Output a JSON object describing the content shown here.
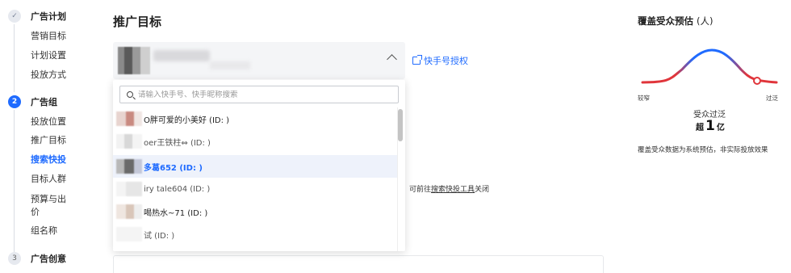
{
  "steps": [
    {
      "title": "广告计划",
      "badge": "✓",
      "state": "done",
      "items": [
        "营销目标",
        "计划设置",
        "投放方式"
      ]
    },
    {
      "title": "广告组",
      "badge": "2",
      "state": "active",
      "items": [
        "投放位置",
        "推广目标",
        "搜索快投",
        "目标人群",
        "预算与出",
        "价",
        "组名称"
      ],
      "current": "搜索快投"
    },
    {
      "title": "广告创意",
      "badge": "3",
      "state": "todo"
    }
  ],
  "main": {
    "title": "推广目标",
    "auth_link": "快手号授权",
    "hint_prefix": "可前往",
    "hint_link": "搜索快投工具",
    "hint_suffix": "关闭"
  },
  "dropdown": {
    "search_placeholder": "请输入快手号、快手昵称搜索",
    "options": [
      {
        "text": "O胖可爱的小美好 (ID:                  )",
        "state": "normal"
      },
      {
        "text": "oer王铁柱⇔ (ID:                  )",
        "state": "dim"
      },
      {
        "text": "多葛652 (ID:                    )",
        "state": "selected"
      },
      {
        "text": "iry tale604 (ID:                  )",
        "state": "dim"
      },
      {
        "text": "喝热水~71 (ID:                  )",
        "state": "normal"
      },
      {
        "text": "试 (ID:                  )",
        "state": "dim"
      }
    ]
  },
  "panel": {
    "title": "覆盖受众预估",
    "unit": "(人)",
    "axis_left": "较窄",
    "axis_right": "过泛",
    "estimate_label": "受众过泛",
    "estimate_prefix": "超",
    "estimate_number": "1",
    "estimate_suffix": "亿",
    "note": "覆盖受众数据为系统预估，非实际投放效果",
    "colors": {
      "low": "#e0353b",
      "mid": "#1f6bff",
      "marker": "#e0353b"
    }
  }
}
